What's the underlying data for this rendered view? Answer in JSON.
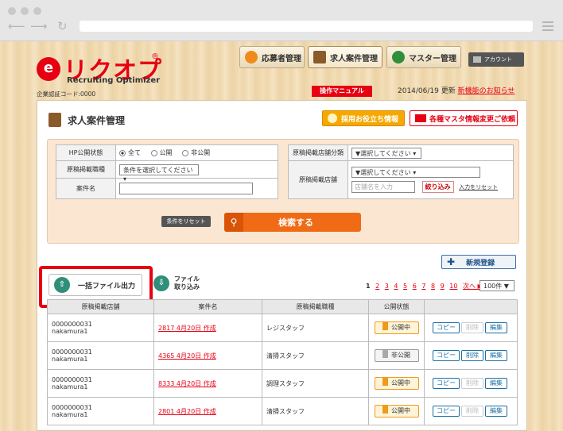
{
  "header": {
    "logo_text": "リクオプ",
    "logo_mark": "e",
    "logo_reg": "®",
    "logo_sub": "Recruiting Optimizer",
    "auth_code": "企業認証コード:0000",
    "tabs": [
      {
        "label": "応募者管理",
        "icon": "person-icon"
      },
      {
        "label": "求人案件管理",
        "icon": "book-icon"
      },
      {
        "label": "マスター管理",
        "icon": "gear-icon"
      }
    ],
    "account_label": "アカウント",
    "manual_label": "操作マニュアル",
    "update_date": "2014/06/19 更新",
    "update_link": "新機能のお知らせ"
  },
  "page": {
    "title": "求人案件管理",
    "tips_label": "採用お役立ち情報",
    "mail_label": "各種マスタ情報変更ご依頼"
  },
  "search": {
    "hp_status_label": "HP公開状態",
    "radio_all": "全て",
    "radio_public": "公開",
    "radio_private": "非公開",
    "job_type_label": "原稿掲載職種",
    "job_type_value": "条件を選択してください",
    "case_name_label": "案件名",
    "store_category_label": "原稿掲載店舗分類",
    "store_category_value": "▼選択してください",
    "store_label": "原稿掲載店舗",
    "store_value": "▼選択してください",
    "store_placeholder": "店舗名を入力",
    "narrow_label": "絞り込み",
    "input_reset_label": "入力をリセット",
    "reset_label": "条件をリセット",
    "search_label": "検索する"
  },
  "actions": {
    "new_label": "新規登録",
    "export_label": "一括ファイル出力",
    "import_label_1": "ファイル",
    "import_label_2": "取り込み",
    "pages": [
      "1",
      "2",
      "3",
      "4",
      "5",
      "6",
      "7",
      "8",
      "9",
      "10"
    ],
    "next_label": "次へ ▶",
    "per_page": "100件 ▼"
  },
  "table": {
    "headers": [
      "原稿掲載店舗",
      "案件名",
      "原稿掲載職種",
      "公開状態",
      ""
    ],
    "rows": [
      {
        "id": "0000000031",
        "user": "nakamura1",
        "name": "2817 4月20日 作成",
        "job": "レジスタッフ",
        "status": "公開中",
        "public": true
      },
      {
        "id": "0000000031",
        "user": "nakamura1",
        "name": "4365 4月20日 作成",
        "job": "清掃スタッフ",
        "status": "非公開",
        "public": false
      },
      {
        "id": "0000000031",
        "user": "nakamura1",
        "name": "8333 4月20日 作成",
        "job": "調理スタッフ",
        "status": "公開中",
        "public": true
      },
      {
        "id": "0000000031",
        "user": "nakamura1",
        "name": "2801 4月20日 作成",
        "job": "清掃スタッフ",
        "status": "公開中",
        "public": true
      }
    ],
    "copy_label": "コピー",
    "delete_label": "削除",
    "edit_label": "編集"
  },
  "colors": {
    "brand_red": "#e60012",
    "search_orange": "#f06b16",
    "accent_blue": "#1d6fa5"
  }
}
